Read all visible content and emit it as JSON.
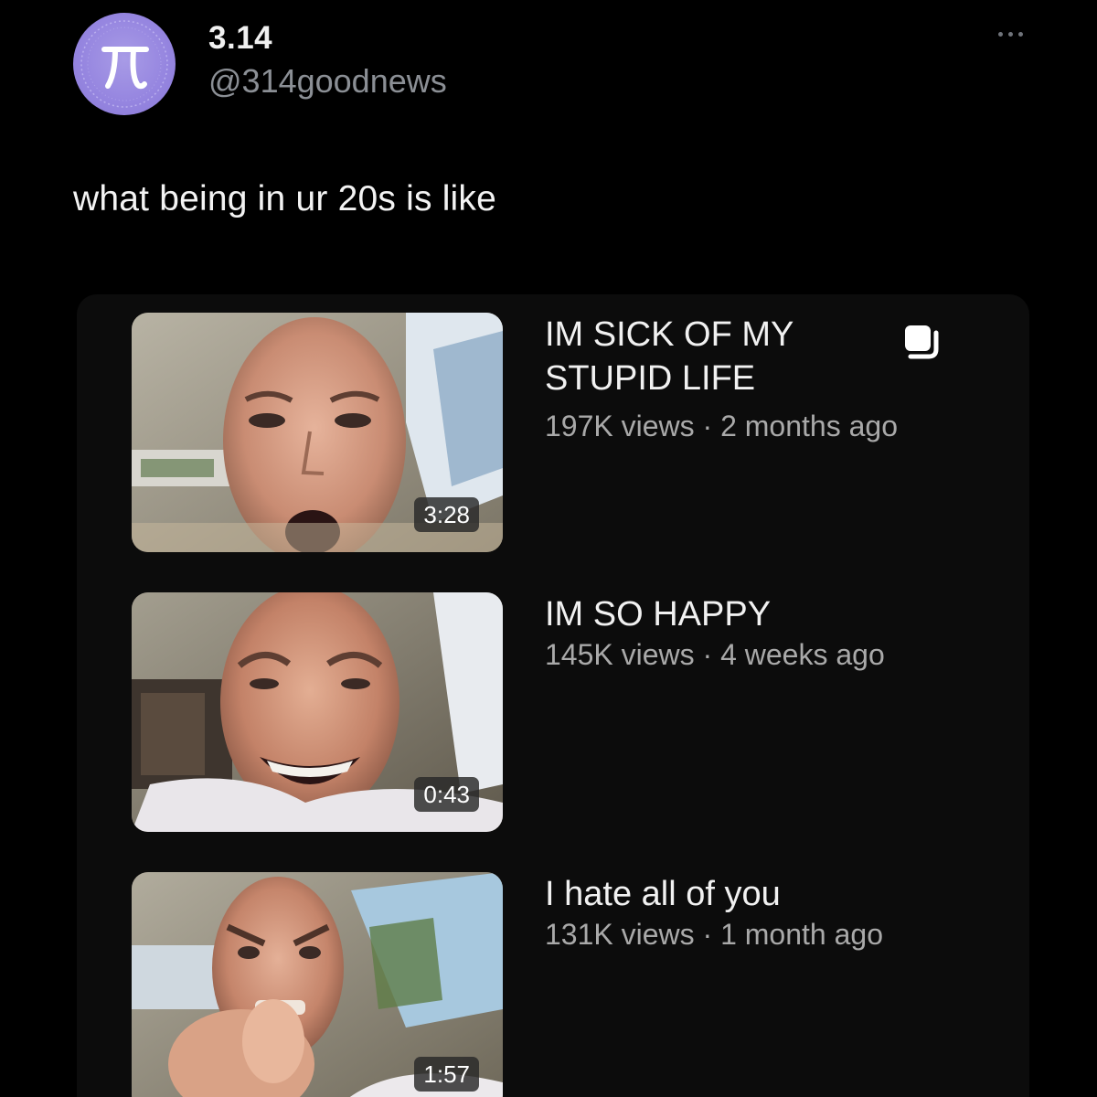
{
  "tweet": {
    "author_name": "3.14",
    "author_handle": "@314goodnews",
    "avatar_icon": "pi-symbol-icon",
    "avatar_color": "#9686e0",
    "more_icon": "more-horizontal-icon",
    "text": "what being in ur 20s is like"
  },
  "videos": [
    {
      "title_line1": "IM SICK OF MY",
      "title_line2": "STUPID LIFE",
      "views": "197K views",
      "age": "2 months ago",
      "duration": "3:28",
      "icon": "add-to-queue-icon"
    },
    {
      "title_line1": "IM SO HAPPY",
      "title_line2": "",
      "views": "145K views",
      "age": "4 weeks ago",
      "duration": "0:43"
    },
    {
      "title_line1": "I hate all of you",
      "title_line2": "",
      "views": "131K views",
      "age": "1 month ago",
      "duration": "1:57"
    }
  ],
  "meta_separator": " · ",
  "colors": {
    "background": "#000000",
    "card": "#0c0c0c",
    "meta_text": "#a9a9a9",
    "handle_text": "#8b8f95"
  }
}
